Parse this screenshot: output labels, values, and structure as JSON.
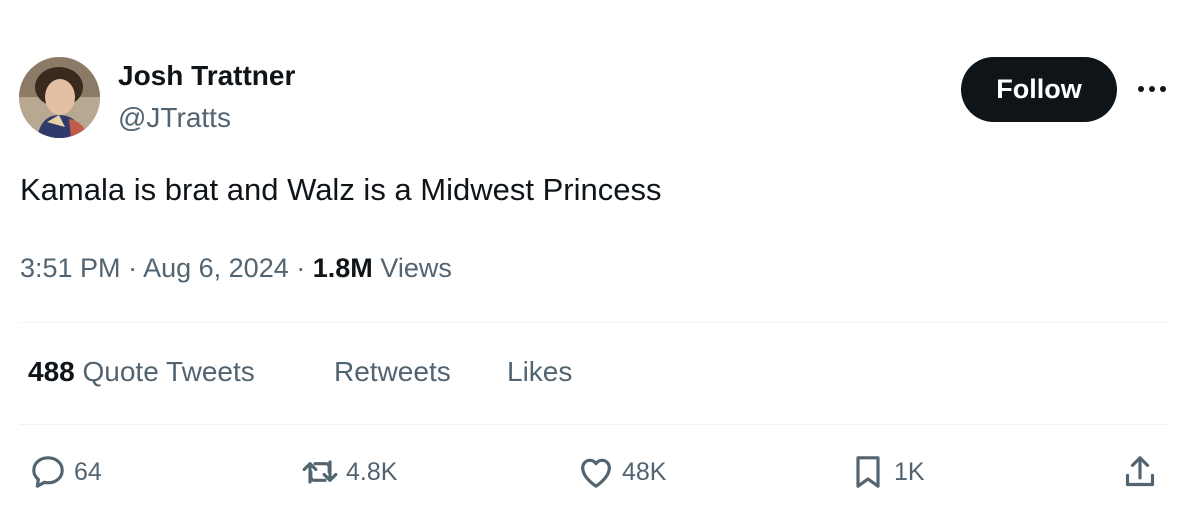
{
  "author": {
    "name": "Josh Trattner",
    "handle": "@JTratts"
  },
  "follow_label": "Follow",
  "more_icon": "more-horizontal-icon",
  "tweet": {
    "text": "Kamala is brat and Walz is a Midwest Princess",
    "time": "3:51 PM",
    "separator": "·",
    "date": "Aug 6, 2024",
    "views_count": "1.8M",
    "views_label": "Views"
  },
  "stats": {
    "quote_count": "488",
    "quote_label": "Quote Tweets",
    "retweets_label": "Retweets",
    "likes_label": "Likes"
  },
  "actions": {
    "reply": {
      "icon": "reply-icon",
      "count": "64"
    },
    "retweet": {
      "icon": "retweet-icon",
      "count": "4.8K"
    },
    "like": {
      "icon": "heart-icon",
      "count": "48K"
    },
    "bookmark": {
      "icon": "bookmark-icon",
      "count": "1K"
    },
    "share": {
      "icon": "share-icon"
    }
  },
  "colors": {
    "text_primary": "#0f1419",
    "text_secondary": "#536471",
    "divider": "#eff3f4",
    "follow_bg": "#0f1419"
  }
}
